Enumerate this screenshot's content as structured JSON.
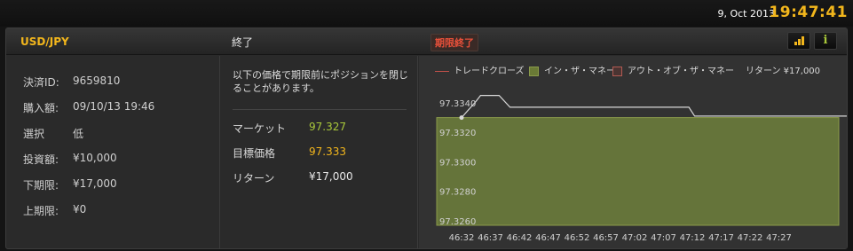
{
  "topbar": {
    "date": "9, Oct 2013",
    "time": "19:47:41"
  },
  "header": {
    "pair": "USD/JPY",
    "status": "終了",
    "expired_badge": "期限終了",
    "signal_icon": "signal-bars-icon",
    "info_icon": "info-icon"
  },
  "details": [
    {
      "label": "決済ID:",
      "value": "9659810"
    },
    {
      "label": "購入額:",
      "value": "09/10/13 19:46"
    },
    {
      "label": "選択",
      "value": "低"
    },
    {
      "label": "投資額:",
      "value": "¥10,000"
    },
    {
      "label": "下期限:",
      "value": "¥17,000"
    },
    {
      "label": "上期限:",
      "value": "¥0"
    }
  ],
  "notice": "以下の価格で期限前にポジションを閉じることがあります。",
  "quotes": {
    "market": {
      "label": "マーケット",
      "value": "97.327"
    },
    "target": {
      "label": "目標価格",
      "value": "97.333"
    },
    "return": {
      "label": "リターン",
      "value": "¥17,000"
    }
  },
  "legend": {
    "trade_close": "トレードクローズ",
    "in_the_money": "イン・ザ・マネー",
    "out_of_money": "アウト・オブ・ザ・マネー",
    "return_label": "リターン ¥17,000"
  },
  "colors": {
    "accent": "#f2b61c",
    "positive": "#a9c83a",
    "negative": "#e8503a",
    "in_the_money_fill": "#65743a",
    "trade_line": "#c0504a"
  },
  "chart_data": {
    "type": "area",
    "x": [
      "46:32",
      "46:37",
      "46:42",
      "46:47",
      "46:52",
      "46:57",
      "47:02",
      "47:07",
      "47:12",
      "47:17",
      "47:22",
      "47:27"
    ],
    "y_ticks": [
      97.326,
      97.328,
      97.33,
      97.332,
      97.334
    ],
    "y_tick_labels": [
      "97.3260",
      "97.3280",
      "97.3300",
      "97.3320",
      "97.3340"
    ],
    "ylim": [
      97.3257,
      97.3352
    ],
    "target": 97.333,
    "in_the_money_region": "below",
    "start_point": {
      "x": "46:32",
      "y": 97.333
    },
    "series": [
      {
        "points": [
          {
            "t": 32,
            "v": 97.333
          },
          {
            "t": 34.5,
            "v": 97.3341
          },
          {
            "t": 35.3,
            "v": 97.3345
          },
          {
            "t": 38.5,
            "v": 97.3345
          },
          {
            "t": 40.4,
            "v": 97.3337
          },
          {
            "t": 71.4,
            "v": 97.3337
          },
          {
            "t": 72.4,
            "v": 97.3331
          },
          {
            "t": 99,
            "v": 97.3331
          },
          {
            "t": 101.2,
            "v": 97.3306
          },
          {
            "t": 103.9,
            "v": 97.3306
          },
          {
            "t": 106,
            "v": 97.3264
          }
        ]
      }
    ]
  }
}
